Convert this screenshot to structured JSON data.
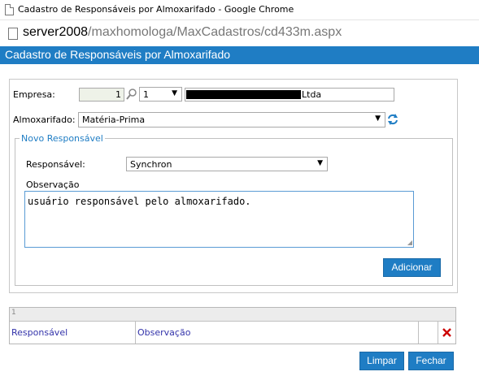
{
  "window": {
    "title": "Cadastro de Responsáveis por Almoxarifado - Google Chrome"
  },
  "address_bar": {
    "host": "server2008",
    "path": "/maxhomologa/MaxCadastros/cd433m.aspx"
  },
  "page": {
    "header_title": "Cadastro de Responsáveis por Almoxarifado"
  },
  "form": {
    "empresa_label": "Empresa:",
    "empresa_code": "1",
    "empresa_select": "1",
    "empresa_name_suffix": "Ltda",
    "almoxarifado_label": "Almoxarifado:",
    "almoxarifado_value": "Matéria-Prima",
    "novo_responsavel_legend": "Novo Responsável",
    "responsavel_label": "Responsável:",
    "responsavel_value": "Synchron",
    "observacao_label": "Observação",
    "observacao_value": "usuário responsável pelo almoxarifado.",
    "adicionar_label": "Adicionar"
  },
  "grid": {
    "pager_text": "1",
    "columns": [
      "Responsável",
      "Observação"
    ]
  },
  "footer": {
    "limpar_label": "Limpar",
    "fechar_label": "Fechar"
  },
  "colors": {
    "accent": "#1f7dc4",
    "delete": "#cc0000"
  }
}
